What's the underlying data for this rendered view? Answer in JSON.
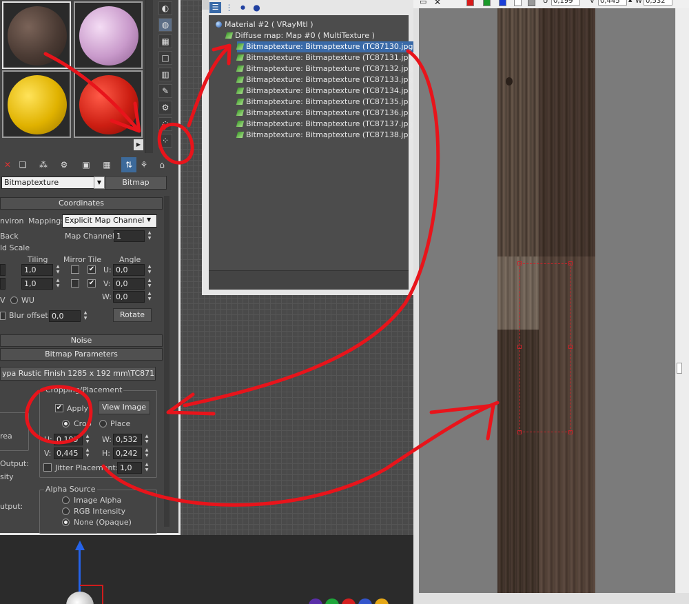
{
  "navigator": {
    "root": "Material #2  ( VRayMtl )",
    "diffuse": "Diffuse map: Map #0  ( MultiTexture )",
    "maps": [
      "Bitmaptexture: Bitmaptexture (TC87130.jpg)",
      "Bitmaptexture: Bitmaptexture (TC87131.jpg)",
      "Bitmaptexture: Bitmaptexture (TC87132.jpg)",
      "Bitmaptexture: Bitmaptexture (TC87133.jpg)",
      "Bitmaptexture: Bitmaptexture (TC87134.jpg)",
      "Bitmaptexture: Bitmaptexture (TC87135.jpg)",
      "Bitmaptexture: Bitmaptexture (TC87136.jpg)",
      "Bitmaptexture: Bitmaptexture (TC87137.jpg)",
      "Bitmaptexture: Bitmaptexture (TC87138.jpg)"
    ]
  },
  "editor": {
    "map_name": "Bitmaptexture",
    "map_type_button": "Bitmap",
    "coordinates": {
      "rollout": "Coordinates",
      "environ_label": "nviron",
      "mapping_label": "Mapping:",
      "mapping_value": "Explicit Map Channel",
      "map_channel_label": "Map Channel:",
      "map_channel_value": "1",
      "back_label": "Back",
      "scale_label": "ld Scale",
      "tiling_label": "Tiling",
      "mirror_tile_label": "Mirror Tile",
      "angle_label": "Angle",
      "tiling_u": "1,0",
      "tiling_v": "1,0",
      "angle_u_label": "U:",
      "angle_v_label": "V:",
      "angle_w_label": "W:",
      "angle_u": "0,0",
      "angle_v": "0,0",
      "angle_w": "0,0",
      "uv_label": "V",
      "wu_label": "WU",
      "blur_offset_label": "Blur offset:",
      "blur_offset_value": "0,0",
      "rotate_button": "Rotate"
    },
    "noise_rollout": "Noise",
    "bitmap_params": {
      "rollout": "Bitmap Parameters",
      "path": "ypa Rustic Finish  1285 x 192 mm\\TC87130.jpg",
      "cropping_label": "Cropping/Placement",
      "apply_label": "Apply",
      "view_image_button": "View Image",
      "crop_label": "Crop",
      "place_label": "Place",
      "u_label": "U:",
      "v_label": "V:",
      "w_label": "W:",
      "h_label": "H:",
      "u_value": "0,199",
      "v_value": "0,445",
      "w_value": "0,532",
      "h_value": "0,242",
      "jitter_label": "Jitter Placement:",
      "jitter_value": "1,0",
      "area_label": "rea",
      "output_label": "Output:",
      "intensity_label": "sity",
      "output2_label": "utput:",
      "alpha_source_label": "Alpha Source",
      "alpha_options": [
        "Image Alpha",
        "RGB Intensity",
        "None (Opaque)"
      ]
    }
  },
  "viewer": {
    "u_label": "U",
    "u_value": "0,199",
    "v_label": "V",
    "v_value": "0,445",
    "w_label": "W",
    "w_value": "0,532"
  },
  "colors": {
    "selection": "#3a6aa8",
    "annotation": "#e8141b"
  },
  "icons": [
    "close-icon",
    "tree-icon",
    "sphere-icon",
    "checker-icon"
  ]
}
